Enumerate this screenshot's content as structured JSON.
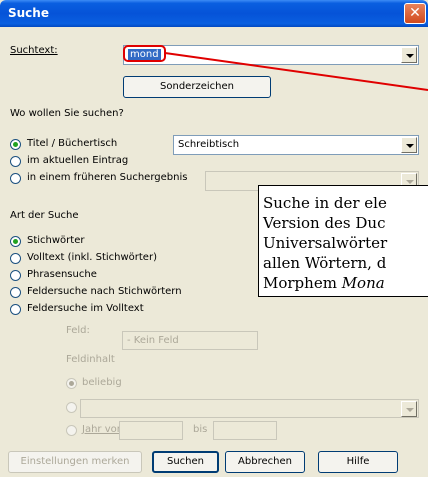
{
  "window": {
    "title": "Suche",
    "close_glyph": "✕"
  },
  "search": {
    "label": "Suchtext:",
    "value": "mond",
    "special_chars_button": "Sonderzeichen"
  },
  "where": {
    "heading": "Wo wollen Sie suchen?",
    "options": [
      "Titel / Büchertisch",
      "im aktuellen Eintrag",
      "in einem früheren Suchergebnis"
    ],
    "title_combo": "Schreibtisch",
    "earlier_combo": ""
  },
  "kind": {
    "heading": "Art der Suche",
    "options": [
      "Stichwörter",
      "Volltext (inkl. Stichwörter)",
      "Phrasensuche",
      "Feldersuche nach Stichwörtern",
      "Feldersuche im Volltext"
    ]
  },
  "field": {
    "label": "Feld:",
    "value": "- Kein Feld",
    "content_label": "Feldinhalt",
    "opt_any": "beliebig",
    "opt_year_from": "Jahr von",
    "year_to": "bis"
  },
  "buttons": {
    "save_settings": "Einstellungen merken",
    "search": "Suchen",
    "cancel": "Abbrechen",
    "help": "Hilfe"
  },
  "callout": {
    "lines": [
      "Suche in der ele",
      "Version des Duc",
      "Universalwörter",
      "allen Wörtern, d"
    ],
    "last_prefix": "Morphem ",
    "last_italic": "Mona"
  },
  "colors": {
    "titlebar": "#0553d8",
    "dialog_bg": "#ece9d8",
    "highlight": "#316ac5",
    "annotation_red": "#e00000"
  }
}
